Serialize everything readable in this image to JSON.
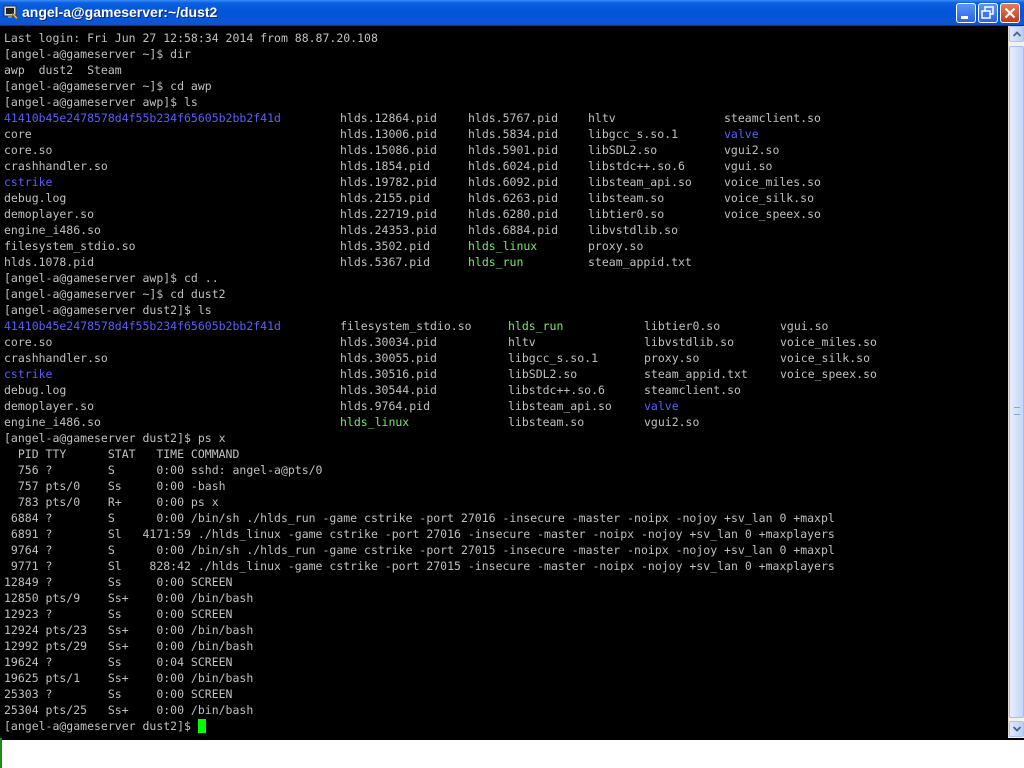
{
  "window": {
    "title": "angel-a@gameserver:~/dust2"
  },
  "colors": {
    "title_bar": "#0454d8",
    "terminal_bg": "#000000",
    "text": "#c0c0c0",
    "directory": "#5c5cff",
    "executable": "#7ce36a",
    "cursor": "#00ff00"
  },
  "icons": {
    "app": "terminal-app-icon",
    "minimize": "minimize-icon",
    "maximize": "restore-icon",
    "close": "close-icon"
  },
  "terminal": {
    "lines": [
      {
        "text": "Last login: Fri Jun 27 12:58:34 2014 from 88.87.20.108"
      },
      {
        "text": "[angel-a@gameserver ~]$ dir"
      },
      {
        "text": "awp  dust2  Steam"
      },
      {
        "text": "[angel-a@gameserver ~]$ cd awp"
      },
      {
        "text": "[angel-a@gameserver awp]$ ls"
      },
      {
        "cols": [
          {
            "text": "41410b45e2478578d4f55b234f65605b2bb2f41d",
            "color": "blue"
          },
          {
            "text": "hlds.12864.pid"
          },
          {
            "text": "hlds.5767.pid"
          },
          {
            "text": "hltv"
          },
          {
            "text": "steamclient.so"
          }
        ]
      },
      {
        "cols": [
          {
            "text": "core"
          },
          {
            "text": "hlds.13006.pid"
          },
          {
            "text": "hlds.5834.pid"
          },
          {
            "text": "libgcc_s.so.1"
          },
          {
            "text": "valve",
            "color": "blue"
          }
        ]
      },
      {
        "cols": [
          {
            "text": "core.so"
          },
          {
            "text": "hlds.15086.pid"
          },
          {
            "text": "hlds.5901.pid"
          },
          {
            "text": "libSDL2.so"
          },
          {
            "text": "vgui2.so"
          }
        ]
      },
      {
        "cols": [
          {
            "text": "crashhandler.so"
          },
          {
            "text": "hlds.1854.pid"
          },
          {
            "text": "hlds.6024.pid"
          },
          {
            "text": "libstdc++.so.6"
          },
          {
            "text": "vgui.so"
          }
        ]
      },
      {
        "cols": [
          {
            "text": "cstrike",
            "color": "blue"
          },
          {
            "text": "hlds.19782.pid"
          },
          {
            "text": "hlds.6092.pid"
          },
          {
            "text": "libsteam_api.so"
          },
          {
            "text": "voice_miles.so"
          }
        ]
      },
      {
        "cols": [
          {
            "text": "debug.log"
          },
          {
            "text": "hlds.2155.pid"
          },
          {
            "text": "hlds.6263.pid"
          },
          {
            "text": "libsteam.so"
          },
          {
            "text": "voice_silk.so"
          }
        ]
      },
      {
        "cols": [
          {
            "text": "demoplayer.so"
          },
          {
            "text": "hlds.22719.pid"
          },
          {
            "text": "hlds.6280.pid"
          },
          {
            "text": "libtier0.so"
          },
          {
            "text": "voice_speex.so"
          }
        ]
      },
      {
        "cols": [
          {
            "text": "engine_i486.so"
          },
          {
            "text": "hlds.24353.pid"
          },
          {
            "text": "hlds.6884.pid"
          },
          {
            "text": "libvstdlib.so"
          },
          {
            "text": ""
          }
        ]
      },
      {
        "cols": [
          {
            "text": "filesystem_stdio.so"
          },
          {
            "text": "hlds.3502.pid"
          },
          {
            "text": "hlds_linux",
            "color": "green"
          },
          {
            "text": "proxy.so"
          },
          {
            "text": ""
          }
        ]
      },
      {
        "cols": [
          {
            "text": "hlds.1078.pid"
          },
          {
            "text": "hlds.5367.pid"
          },
          {
            "text": "hlds_run",
            "color": "green"
          },
          {
            "text": "steam_appid.txt"
          },
          {
            "text": ""
          }
        ]
      },
      {
        "text": "[angel-a@gameserver awp]$ cd .."
      },
      {
        "text": "[angel-a@gameserver ~]$ cd dust2"
      },
      {
        "text": "[angel-a@gameserver dust2]$ ls"
      },
      {
        "cols": [
          {
            "text": "41410b45e2478578d4f55b234f65605b2bb2f41d",
            "color": "blue"
          },
          {
            "text": "filesystem_stdio.so"
          },
          {
            "text": "hlds_run",
            "color": "green"
          },
          {
            "text": "libtier0.so"
          },
          {
            "text": "vgui.so"
          }
        ]
      },
      {
        "cols": [
          {
            "text": "core.so"
          },
          {
            "text": "hlds.30034.pid"
          },
          {
            "text": "hltv"
          },
          {
            "text": "libvstdlib.so"
          },
          {
            "text": "voice_miles.so"
          }
        ]
      },
      {
        "cols": [
          {
            "text": "crashhandler.so"
          },
          {
            "text": "hlds.30055.pid"
          },
          {
            "text": "libgcc_s.so.1"
          },
          {
            "text": "proxy.so"
          },
          {
            "text": "voice_silk.so"
          }
        ]
      },
      {
        "cols": [
          {
            "text": "cstrike",
            "color": "blue"
          },
          {
            "text": "hlds.30516.pid"
          },
          {
            "text": "libSDL2.so"
          },
          {
            "text": "steam_appid.txt"
          },
          {
            "text": "voice_speex.so"
          }
        ]
      },
      {
        "cols": [
          {
            "text": "debug.log"
          },
          {
            "text": "hlds.30544.pid"
          },
          {
            "text": "libstdc++.so.6"
          },
          {
            "text": "steamclient.so"
          },
          {
            "text": ""
          }
        ]
      },
      {
        "cols": [
          {
            "text": "demoplayer.so"
          },
          {
            "text": "hlds.9764.pid"
          },
          {
            "text": "libsteam_api.so"
          },
          {
            "text": "valve",
            "color": "blue"
          },
          {
            "text": ""
          }
        ]
      },
      {
        "cols": [
          {
            "text": "engine_i486.so"
          },
          {
            "text": "hlds_linux",
            "color": "green"
          },
          {
            "text": "libsteam.so"
          },
          {
            "text": "vgui2.so"
          },
          {
            "text": ""
          }
        ]
      },
      {
        "text": "[angel-a@gameserver dust2]$ ps x"
      },
      {
        "text": "  PID TTY      STAT   TIME COMMAND"
      },
      {
        "text": "  756 ?        S      0:00 sshd: angel-a@pts/0"
      },
      {
        "text": "  757 pts/0    Ss     0:00 -bash"
      },
      {
        "text": "  783 pts/0    R+     0:00 ps x"
      },
      {
        "text": " 6884 ?        S      0:00 /bin/sh ./hlds_run -game cstrike -port 27016 -insecure -master -noipx -nojoy +sv_lan 0 +maxpl"
      },
      {
        "text": " 6891 ?        Sl   4171:59 ./hlds_linux -game cstrike -port 27016 -insecure -master -noipx -nojoy +sv_lan 0 +maxplayers"
      },
      {
        "text": " 9764 ?        S      0:00 /bin/sh ./hlds_run -game cstrike -port 27015 -insecure -master -noipx -nojoy +sv_lan 0 +maxpl"
      },
      {
        "text": " 9771 ?        Sl    828:42 ./hlds_linux -game cstrike -port 27015 -insecure -master -noipx -nojoy +sv_lan 0 +maxplayers"
      },
      {
        "text": "12849 ?        Ss     0:00 SCREEN"
      },
      {
        "text": "12850 pts/9    Ss+    0:00 /bin/bash"
      },
      {
        "text": "12923 ?        Ss     0:00 SCREEN"
      },
      {
        "text": "12924 pts/23   Ss+    0:00 /bin/bash"
      },
      {
        "text": "12992 pts/29   Ss+    0:00 /bin/bash"
      },
      {
        "text": "19624 ?        Ss     0:04 SCREEN"
      },
      {
        "text": "19625 pts/1    Ss+    0:00 /bin/bash"
      },
      {
        "text": "25303 ?        Ss     0:00 SCREEN"
      },
      {
        "text": "25304 pts/25   Ss+    0:00 /bin/bash"
      },
      {
        "text": "[angel-a@gameserver dust2]$ ",
        "cursor": true
      }
    ]
  }
}
